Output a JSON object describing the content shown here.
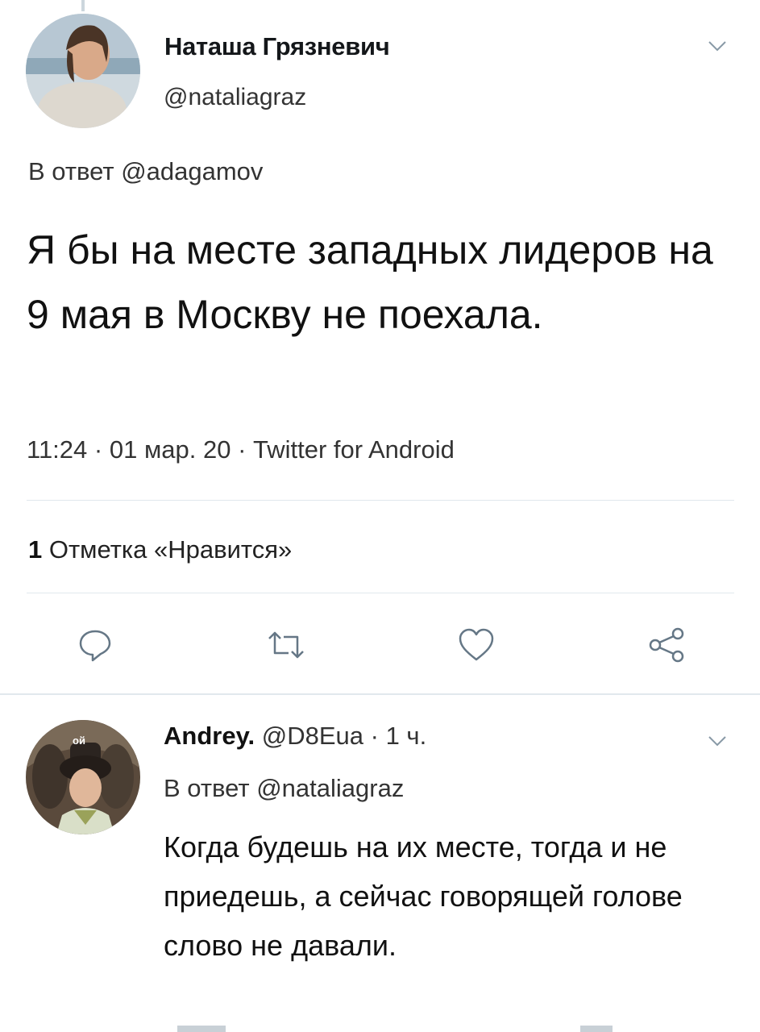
{
  "tweet": {
    "display_name": "Наташа Грязневич",
    "handle": "@nataliagraz",
    "reply_to": "В ответ @adagamov",
    "text": "Я бы на месте западных лидеров на 9 мая в Москву не поехала.",
    "time": "11:24",
    "date": "01 мар. 20",
    "source": "Twitter for Android",
    "likes_count": "1",
    "likes_label": "Отметка «Нравится»"
  },
  "actions": {
    "reply_icon": "reply-bubble-icon",
    "retweet_icon": "retweet-icon",
    "like_icon": "heart-icon",
    "share_icon": "share-icon"
  },
  "reply": {
    "display_name": "Andrey.",
    "handle": "@D8Eua",
    "time": "1 ч.",
    "reply_to": "В ответ @nataliagraz",
    "text": "Когда будешь на их месте, тогда и не приедешь, а сейчас говорящей голове слово не давали.",
    "avatar_caption": "ой"
  },
  "colors": {
    "icon_gray": "#657786",
    "divider": "#e1e8ed",
    "text": "#14171a"
  }
}
